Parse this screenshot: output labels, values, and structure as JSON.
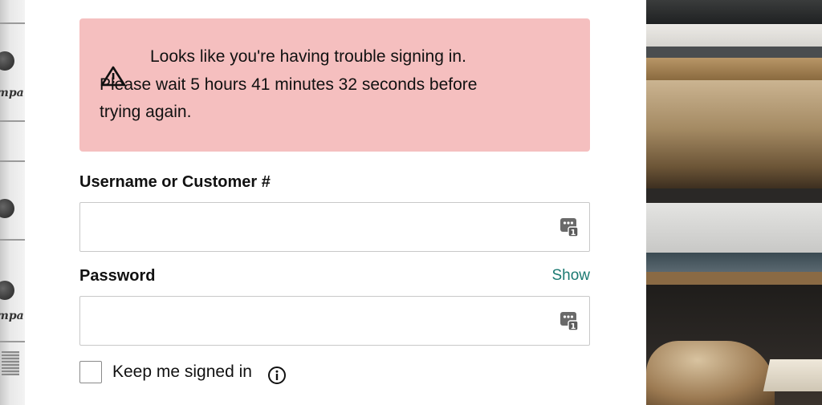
{
  "alert": {
    "icon": "warning-triangle-icon",
    "line1": "Looks like you're having trouble signing in.",
    "line2": "Please wait 5 hours 41 minutes 32 seconds before",
    "line3": "trying again.",
    "background_color": "#f5bfbf"
  },
  "username": {
    "label": "Username or Customer #",
    "value": "",
    "placeholder": "",
    "icon": "password-manager-icon"
  },
  "password": {
    "label": "Password",
    "show_label": "Show",
    "value": "",
    "placeholder": "",
    "icon": "password-manager-icon"
  },
  "remember": {
    "label": "Keep me signed in",
    "checked": false,
    "icon": "info-icon"
  },
  "colors": {
    "link": "#1b7a72",
    "text": "#111111",
    "border": "#c8c8c8"
  }
}
